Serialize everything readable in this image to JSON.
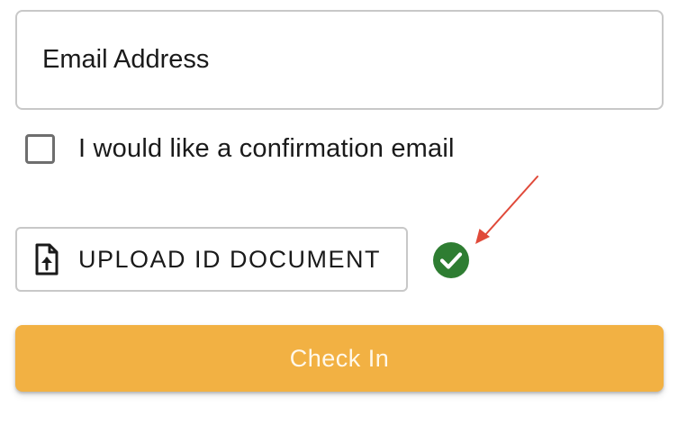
{
  "form": {
    "email": {
      "placeholder": "Email Address",
      "value": ""
    },
    "confirmation": {
      "label": "I would like a confirmation email",
      "checked": false
    },
    "upload": {
      "label": "UPLOAD ID DOCUMENT",
      "icon": "file-upload-icon",
      "status_icon": "check-circle-icon",
      "status": "uploaded"
    },
    "submit": {
      "label": "Check In"
    }
  },
  "annotation": {
    "type": "arrow",
    "points_to": "check-circle-icon"
  },
  "colors": {
    "accent": "#f2b143",
    "success": "#2e7d32",
    "annotation": "#e04a3a",
    "border": "#c8c8c8",
    "text": "#1a1a1a"
  }
}
